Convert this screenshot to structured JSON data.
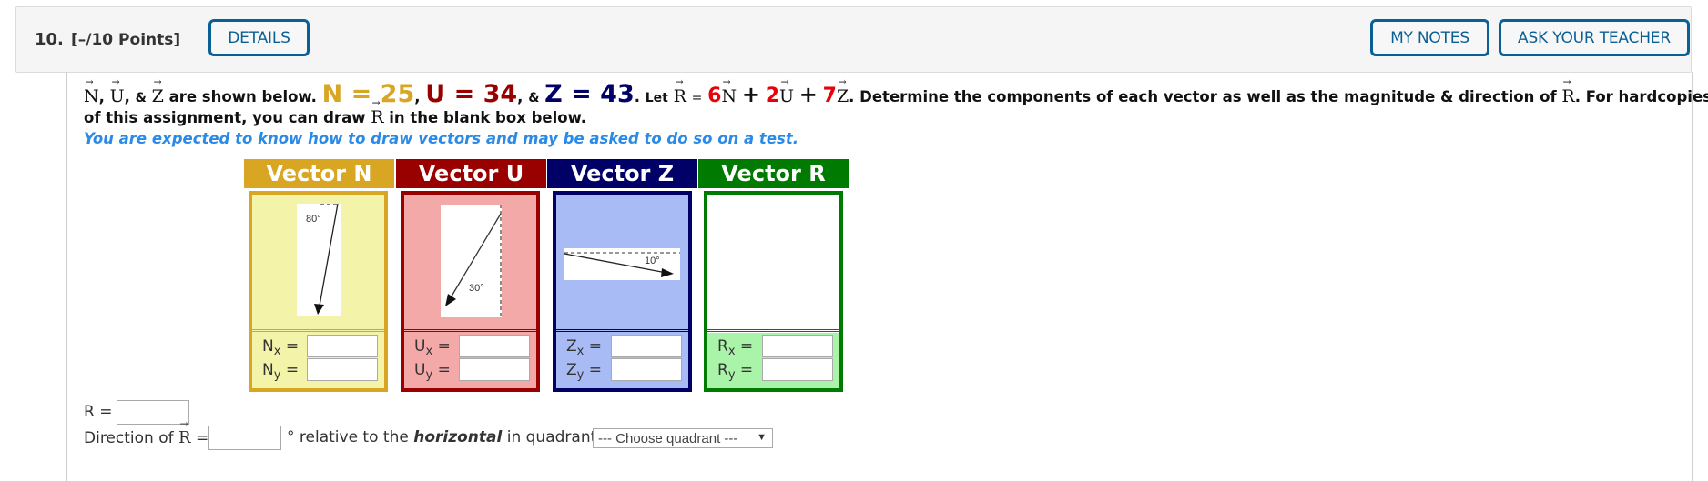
{
  "header": {
    "question_number": "10.",
    "points": "[–/10 Points]",
    "details_label": "DETAILS",
    "my_notes_label": "MY NOTES",
    "ask_teacher_label": "ASK YOUR TEACHER",
    "button_color": "#0a5f94"
  },
  "problem": {
    "vec_n": "N",
    "vec_u": "U",
    "vec_z": "Z",
    "vec_r": "R",
    "amp": "&",
    "shown_below": "are shown below.",
    "n_eq": "N = 25",
    "u_eq": "U = 34",
    "z_eq": "Z = 43",
    "let": "Let",
    "eq": "=",
    "coef_n": "6",
    "coef_u": "2",
    "coef_z": "7",
    "plus": "+",
    "determine": "Determine the components of each vector as well as the magnitude & direction of",
    "for_hardcopies": "For hardcopies",
    "line2_start": "of this assignment, you can draw",
    "line2_end": "in the blank box below.",
    "note": "You are expected to know how to draw vectors and may be asked to do so on a test.",
    "colors": {
      "n": "#d9a623",
      "u": "#990000",
      "z": "#000066",
      "coef": "#e8000b",
      "note": "#2b8ae6"
    }
  },
  "vectors": [
    {
      "title": "Vector N",
      "angle_label": "80°",
      "x_label": "N",
      "y_label": "N",
      "header_color": "#d9a623",
      "box_bg": "#f3f3a9"
    },
    {
      "title": "Vector U",
      "angle_label": "30°",
      "x_label": "U",
      "y_label": "U",
      "header_color": "#990000",
      "box_bg": "#f4a9a9"
    },
    {
      "title": "Vector Z",
      "angle_label": "10°",
      "x_label": "Z",
      "y_label": "Z",
      "header_color": "#000066",
      "box_bg": "#a9bbf4"
    },
    {
      "title": "Vector R",
      "angle_label": "",
      "x_label": "R",
      "y_label": "R",
      "header_color": "#007a00",
      "box_bg": "#aaf4aa"
    }
  ],
  "components": {
    "x_sub": "x",
    "y_sub": "y",
    "eq": "="
  },
  "answer": {
    "r_label": "R =",
    "direction_label": "Direction of",
    "direction_eq": "=",
    "degree_text": "° relative to the",
    "horizontal": "horizontal",
    "in_quadrant": "in quadrant",
    "quadrant_select": "--- Choose quadrant ---",
    "r_value": "",
    "direction_value": ""
  }
}
